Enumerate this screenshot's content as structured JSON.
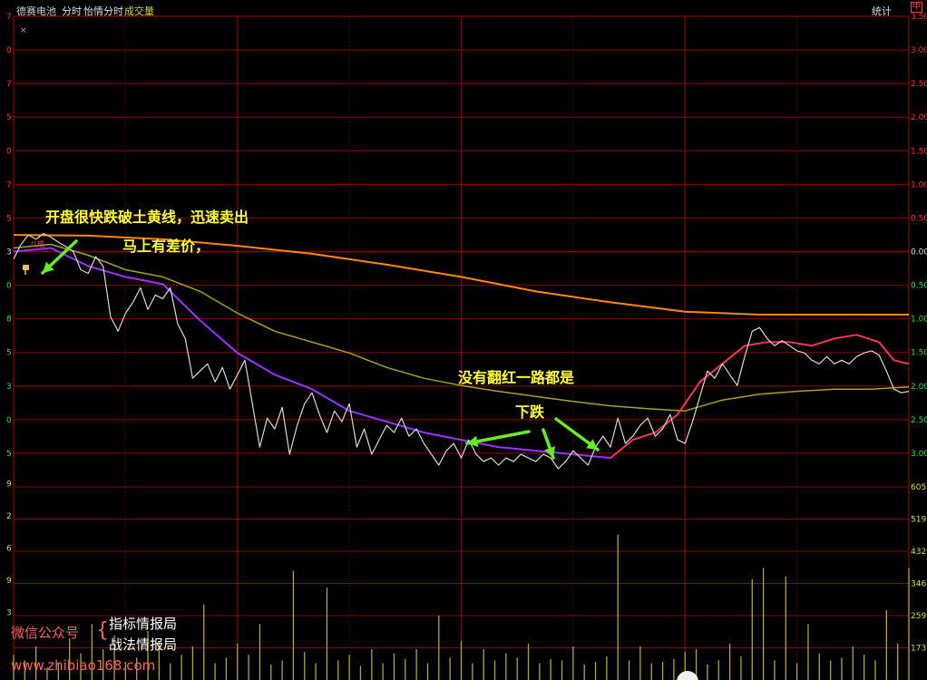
{
  "header": {
    "stock_name": "德赛电池",
    "tab_intraday": "分时",
    "tab_sentiment": "怡情分时",
    "tab_volume": "成交量",
    "stats_button": "统计",
    "corner_label": "中"
  },
  "annotations": {
    "line1": "开盘很快跌破土黄线，迅速卖出",
    "line2": "马上有差价，",
    "line3": "没有翻红一路都是",
    "line4": "下跌",
    "small_label": "八成"
  },
  "watermark": {
    "left_label": "微信公众号",
    "brand1": "指标情报局",
    "brand2": "战法情报局",
    "url": "www.zhibiao168.com"
  },
  "colors": {
    "background": "#000000",
    "grid": "#8b0000",
    "price_line": "#d8d8d8",
    "avg_line": "#9933ff",
    "avg_line_up": "#ff3355",
    "olive_line": "#a8a020",
    "orange_line": "#ff8800",
    "volume_bar": "#b0a828",
    "annotation": "#ffff33",
    "arrow": "#66ee22"
  },
  "chart_data": {
    "type": "line",
    "title": "",
    "xlabel": "",
    "ylabel": "",
    "y_axis_right": [
      "3.50%",
      "3.00%",
      "2.50%",
      "2.00%",
      "1.50%",
      "1.00%",
      "0.50%",
      "0.00%",
      "0.50%",
      "1.00%",
      "1.50%",
      "2.00%",
      "2.50%",
      "3.00%"
    ],
    "y_axis_left_fragments": [
      "7",
      "0",
      "7",
      "5",
      "0",
      "7",
      "5",
      "3",
      "0",
      "8",
      "5",
      "3",
      "0",
      "5"
    ],
    "volume_axis_right": [
      "605",
      "519",
      "432",
      "346",
      "259",
      "173"
    ],
    "volume_axis_left_fragments": [
      "9",
      "2",
      "6",
      "9",
      "3"
    ],
    "price_ylim": [
      -3.0,
      3.5
    ],
    "x_range": [
      0,
      240
    ],
    "series": [
      {
        "key": "price",
        "x": [
          0,
          2,
          4,
          6,
          8,
          10,
          12,
          14,
          16,
          18,
          20,
          22,
          24,
          26,
          28,
          30,
          32,
          34,
          36,
          38,
          40,
          42,
          44,
          46,
          48,
          50,
          52,
          54,
          56,
          58,
          60,
          62,
          64,
          66,
          68,
          70,
          72,
          74,
          76,
          78,
          80,
          82,
          84,
          86,
          88,
          90,
          92,
          94,
          96,
          98,
          100,
          102,
          104,
          106,
          108,
          110,
          112,
          114,
          116,
          118,
          120,
          122,
          124,
          126,
          128,
          130,
          132,
          134,
          136,
          138,
          140,
          142,
          144,
          146,
          148,
          150,
          152,
          154,
          156,
          158,
          160,
          162,
          164,
          166,
          168,
          170,
          172,
          174,
          176,
          178,
          180,
          182,
          184,
          186,
          188,
          190,
          192,
          194,
          196,
          198,
          200,
          202,
          204,
          206,
          208,
          210,
          212,
          214,
          216,
          218,
          220,
          222,
          224,
          226,
          228,
          230,
          232,
          234,
          236,
          238,
          240
        ],
        "values": [
          0.15,
          0.35,
          0.48,
          0.42,
          0.5,
          0.45,
          0.38,
          0.32,
          0.25,
          0.0,
          -0.05,
          0.18,
          0.05,
          -0.65,
          -0.85,
          -0.6,
          -0.45,
          -0.25,
          -0.55,
          -0.35,
          -0.4,
          -0.25,
          -0.75,
          -0.95,
          -1.5,
          -1.4,
          -1.3,
          -1.55,
          -1.35,
          -1.65,
          -1.45,
          -1.25,
          -1.85,
          -2.45,
          -2.05,
          -2.2,
          -1.9,
          -2.55,
          -2.15,
          -1.85,
          -1.7,
          -2.0,
          -2.25,
          -1.95,
          -2.1,
          -1.85,
          -2.45,
          -2.2,
          -2.55,
          -2.35,
          -2.15,
          -2.25,
          -2.05,
          -2.3,
          -2.2,
          -2.4,
          -2.55,
          -2.7,
          -2.5,
          -2.4,
          -2.6,
          -2.35,
          -2.55,
          -2.65,
          -2.6,
          -2.7,
          -2.6,
          -2.65,
          -2.55,
          -2.6,
          -2.65,
          -2.55,
          -2.6,
          -2.75,
          -2.65,
          -2.5,
          -2.6,
          -2.7,
          -2.45,
          -2.3,
          -2.45,
          -2.05,
          -2.4,
          -2.3,
          -2.15,
          -2.05,
          -2.3,
          -2.2,
          -2.0,
          -2.35,
          -2.4,
          -2.1,
          -1.75,
          -1.4,
          -1.5,
          -1.3,
          -1.45,
          -1.6,
          -1.2,
          -0.85,
          -0.8,
          -0.95,
          -1.05,
          -0.98,
          -1.05,
          -1.12,
          -1.15,
          -1.25,
          -1.3,
          -1.2,
          -1.3,
          -1.25,
          -1.3,
          -1.2,
          -1.15,
          -1.12,
          -1.18,
          -1.4,
          -1.65,
          -1.7,
          -1.68
        ]
      },
      {
        "key": "average",
        "x": [
          0,
          10,
          20,
          30,
          40,
          50,
          60,
          70,
          80,
          90,
          100,
          110,
          120,
          130,
          140,
          150,
          160
        ],
        "values": [
          0.25,
          0.3,
          0.05,
          -0.1,
          -0.2,
          -0.7,
          -1.15,
          -1.45,
          -1.65,
          -1.95,
          -2.1,
          -2.25,
          -2.35,
          -2.45,
          -2.5,
          -2.55,
          -2.6
        ]
      },
      {
        "key": "average_after_160",
        "x": [
          160,
          166,
          172,
          178,
          184,
          190,
          196,
          202,
          208,
          214,
          220,
          226,
          232,
          236,
          240
        ],
        "values": [
          -2.6,
          -2.35,
          -2.25,
          -2.0,
          -1.55,
          -1.3,
          -1.05,
          -1.0,
          -1.0,
          -1.05,
          -0.95,
          -0.9,
          -1.0,
          -1.25,
          -1.3
        ]
      },
      {
        "key": "olive",
        "x": [
          0,
          10,
          20,
          30,
          40,
          50,
          60,
          70,
          80,
          90,
          100,
          110,
          120,
          130,
          140,
          150,
          160,
          170,
          180,
          190,
          200,
          210,
          220,
          230,
          240
        ],
        "values": [
          0.3,
          0.35,
          0.2,
          0.0,
          -0.1,
          -0.3,
          -0.6,
          -0.85,
          -1.0,
          -1.15,
          -1.35,
          -1.5,
          -1.6,
          -1.68,
          -1.75,
          -1.82,
          -1.88,
          -1.92,
          -1.95,
          -1.8,
          -1.72,
          -1.68,
          -1.65,
          -1.65,
          -1.62
        ]
      },
      {
        "key": "orange",
        "x": [
          0,
          20,
          40,
          60,
          80,
          100,
          120,
          140,
          160,
          180,
          200,
          220,
          240
        ],
        "values": [
          0.48,
          0.47,
          0.42,
          0.33,
          0.22,
          0.07,
          -0.1,
          -0.3,
          -0.45,
          -0.58,
          -0.62,
          -0.62,
          -0.62
        ]
      }
    ],
    "volume": {
      "ylim": [
        0,
        690
      ],
      "x": [
        0,
        3,
        6,
        9,
        12,
        15,
        18,
        21,
        24,
        27,
        30,
        33,
        36,
        39,
        42,
        45,
        48,
        51,
        54,
        57,
        60,
        63,
        66,
        69,
        72,
        75,
        78,
        81,
        84,
        87,
        90,
        93,
        96,
        99,
        102,
        105,
        108,
        111,
        114,
        117,
        120,
        123,
        126,
        129,
        132,
        135,
        138,
        141,
        144,
        147,
        150,
        153,
        156,
        159,
        162,
        165,
        168,
        171,
        174,
        177,
        180,
        183,
        186,
        189,
        192,
        195,
        198,
        201,
        204,
        207,
        210,
        213,
        216,
        219,
        222,
        225,
        228,
        231,
        234,
        237,
        240
      ],
      "values": [
        90,
        70,
        120,
        45,
        60,
        150,
        95,
        200,
        110,
        160,
        65,
        80,
        175,
        140,
        60,
        90,
        120,
        270,
        60,
        80,
        130,
        90,
        200,
        55,
        70,
        390,
        100,
        60,
        330,
        70,
        90,
        50,
        110,
        60,
        95,
        75,
        110,
        60,
        230,
        80,
        140,
        60,
        110,
        70,
        95,
        80,
        130,
        60,
        75,
        70,
        120,
        55,
        65,
        85,
        520,
        70,
        120,
        60,
        65,
        75,
        100,
        110,
        55,
        70,
        130,
        85,
        360,
        400,
        70,
        370,
        60,
        200,
        95,
        70,
        80,
        120,
        90,
        70,
        250,
        130,
        400
      ]
    }
  }
}
